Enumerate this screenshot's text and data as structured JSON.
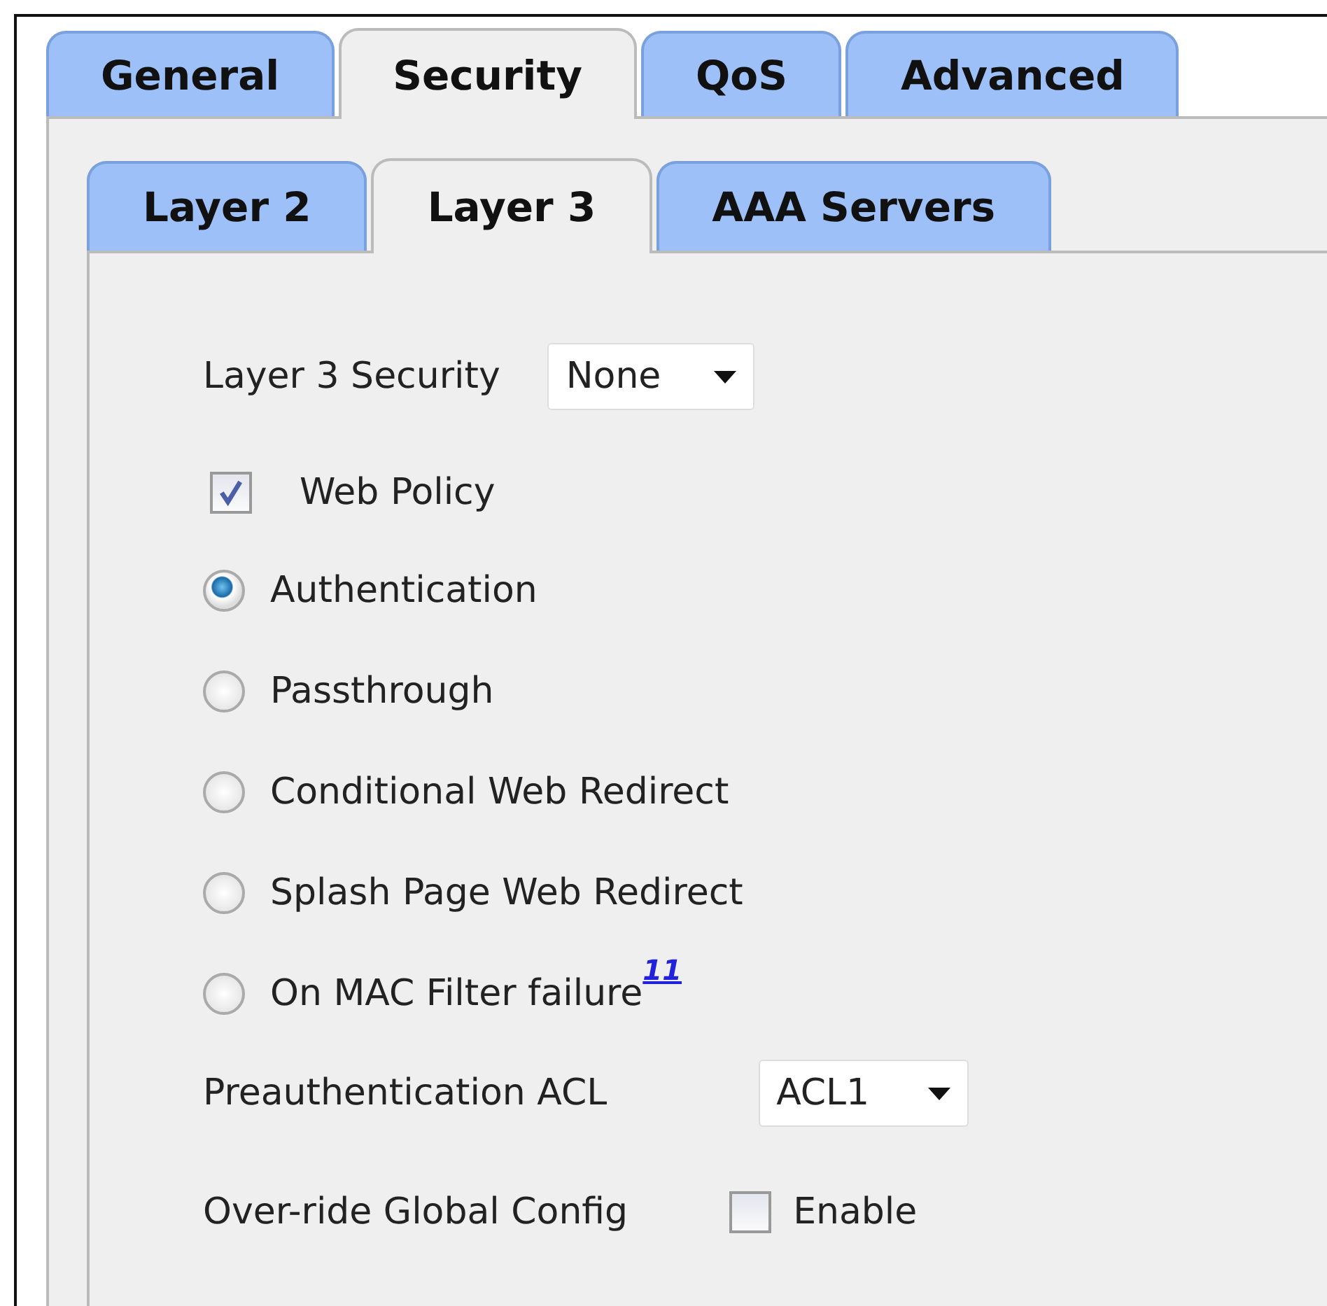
{
  "tabs": [
    {
      "label": "General",
      "selected": false
    },
    {
      "label": "Security",
      "selected": true
    },
    {
      "label": "QoS",
      "selected": false
    },
    {
      "label": "Advanced",
      "selected": false
    }
  ],
  "subtabs": [
    {
      "label": "Layer 2",
      "selected": false
    },
    {
      "label": "Layer 3",
      "selected": true
    },
    {
      "label": "AAA Servers",
      "selected": false
    }
  ],
  "layer3_security": {
    "label": "Layer 3 Security",
    "value": "None"
  },
  "web_policy": {
    "label": "Web Policy",
    "checked": true
  },
  "options": [
    {
      "label": "Authentication",
      "selected": true
    },
    {
      "label": "Passthrough",
      "selected": false
    },
    {
      "label": "Conditional Web Redirect",
      "selected": false
    },
    {
      "label": "Splash Page Web Redirect",
      "selected": false
    },
    {
      "label": "On MAC Filter failure",
      "footnote": "11",
      "selected": false
    }
  ],
  "preauth_acl": {
    "label": "Preauthentication ACL",
    "value": "ACL1"
  },
  "override": {
    "label": "Over-ride Global Config",
    "option": "Enable",
    "checked": false
  }
}
